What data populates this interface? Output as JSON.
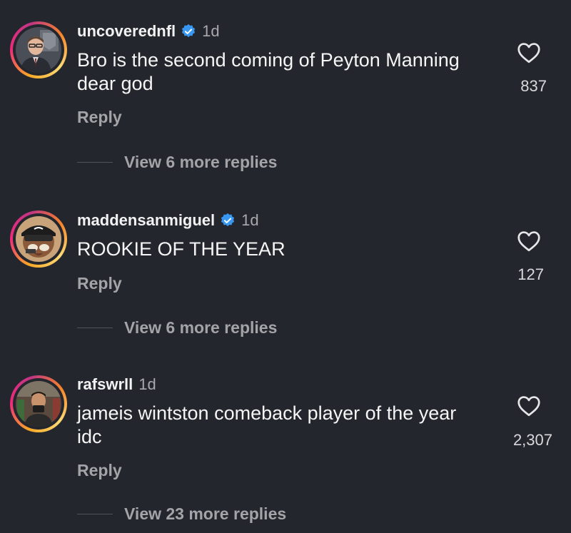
{
  "comments": [
    {
      "username": "uncoverednfl",
      "verified": true,
      "time": "1d",
      "text": "Bro is the second coming of Peyton Manning dear god",
      "reply_label": "Reply",
      "view_replies": "View 6 more replies",
      "likes": "837"
    },
    {
      "username": "maddensanmiguel",
      "verified": true,
      "time": "1d",
      "text": "ROOKIE OF THE YEAR",
      "reply_label": "Reply",
      "view_replies": "View 6 more replies",
      "likes": "127"
    },
    {
      "username": "rafswrll",
      "verified": false,
      "time": "1d",
      "text": "jameis wintston comeback player of the year idc",
      "reply_label": "Reply",
      "view_replies": "View 23 more replies",
      "likes": "2,307"
    }
  ],
  "colors": {
    "background": "#24262d",
    "verified_badge": "#3897f0",
    "secondary_text": "#a3a3a8"
  },
  "icons": {
    "verified": "verified-badge-icon",
    "like": "heart-outline-icon"
  }
}
